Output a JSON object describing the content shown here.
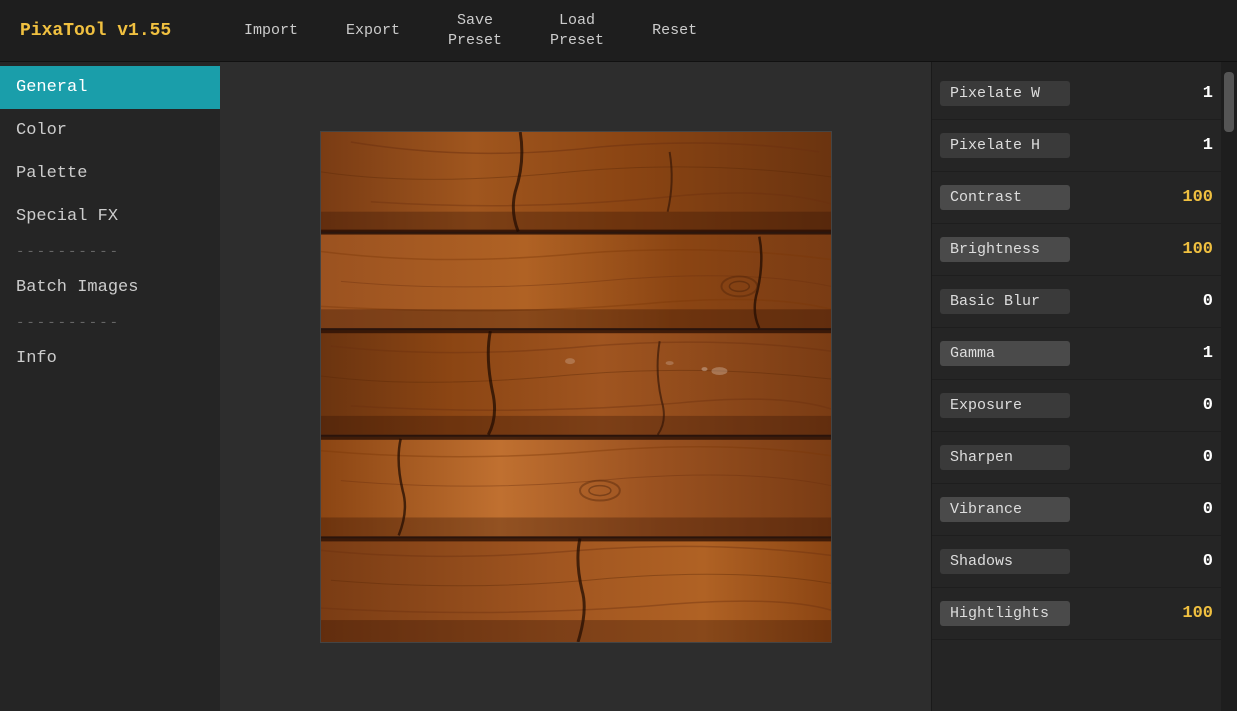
{
  "app": {
    "title": "PixaTool v1.55"
  },
  "menu": {
    "import": "Import",
    "export": "Export",
    "save_preset": "Save\nPreset",
    "load_preset": "Load\nPreset",
    "reset": "Reset"
  },
  "sidebar": {
    "items": [
      {
        "id": "general",
        "label": "General",
        "active": true
      },
      {
        "id": "color",
        "label": "Color",
        "active": false
      },
      {
        "id": "palette",
        "label": "Palette",
        "active": false
      },
      {
        "id": "special-fx",
        "label": "Special FX",
        "active": false
      }
    ],
    "separator1": "----------",
    "batch": "Batch Images",
    "separator2": "----------",
    "info": "Info"
  },
  "params": [
    {
      "id": "pixelate-w",
      "label": "Pixelate W",
      "value": "1",
      "value_color": "white",
      "label_active": false
    },
    {
      "id": "pixelate-h",
      "label": "Pixelate H",
      "value": "1",
      "value_color": "white",
      "label_active": false
    },
    {
      "id": "contrast",
      "label": "Contrast",
      "value": "100",
      "value_color": "gold",
      "label_active": true
    },
    {
      "id": "brightness",
      "label": "Brightness",
      "value": "100",
      "value_color": "gold",
      "label_active": true
    },
    {
      "id": "basic-blur",
      "label": "Basic Blur",
      "value": "0",
      "value_color": "white",
      "label_active": false
    },
    {
      "id": "gamma",
      "label": "Gamma",
      "value": "1",
      "value_color": "white",
      "label_active": true
    },
    {
      "id": "exposure",
      "label": "Exposure",
      "value": "0",
      "value_color": "white",
      "label_active": false
    },
    {
      "id": "sharpen",
      "label": "Sharpen",
      "value": "0",
      "value_color": "white",
      "label_active": false
    },
    {
      "id": "vibrance",
      "label": "Vibrance",
      "value": "0",
      "value_color": "white",
      "label_active": true
    },
    {
      "id": "shadows",
      "label": "Shadows",
      "value": "0",
      "value_color": "white",
      "label_active": false
    },
    {
      "id": "highlights",
      "label": "Hightlights",
      "value": "100",
      "value_color": "gold",
      "label_active": true
    }
  ],
  "colors": {
    "accent": "#1a9eaa",
    "gold": "#f0c040",
    "bg_dark": "#1e1e1e",
    "bg_mid": "#252525",
    "bg_light": "#3a3a3a"
  }
}
